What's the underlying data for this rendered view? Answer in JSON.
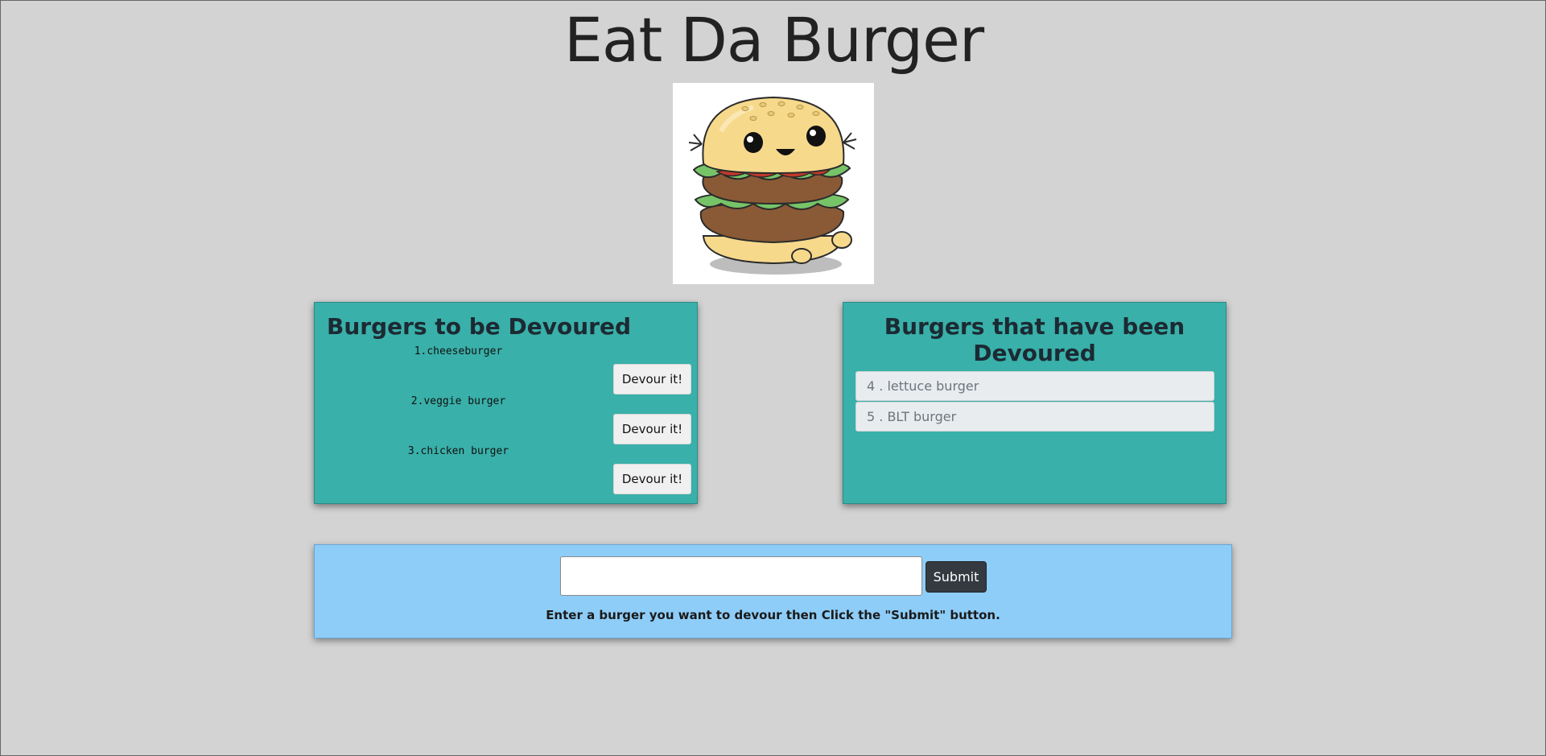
{
  "header": {
    "title": "Eat Da Burger"
  },
  "logo": {
    "icon": "burger-mascot-icon"
  },
  "to_devour": {
    "heading": "Burgers to be Devoured",
    "items": [
      {
        "label": "1.cheeseburger",
        "button": "Devour it!"
      },
      {
        "label": "2.veggie burger",
        "button": "Devour it!"
      },
      {
        "label": "3.chicken burger",
        "button": "Devour it!"
      }
    ]
  },
  "devoured": {
    "heading": "Burgers that have been Devoured",
    "items": [
      {
        "label": "4 . lettuce burger"
      },
      {
        "label": "5 . BLT burger"
      }
    ]
  },
  "form": {
    "input_value": "",
    "submit_label": "Submit",
    "hint": "Enter a burger you want to devour then Click the \"Submit\" button."
  },
  "colors": {
    "background": "#d3d3d3",
    "panel": "#39b0a9",
    "form_panel": "#8ecdf8",
    "submit": "#343a40"
  }
}
